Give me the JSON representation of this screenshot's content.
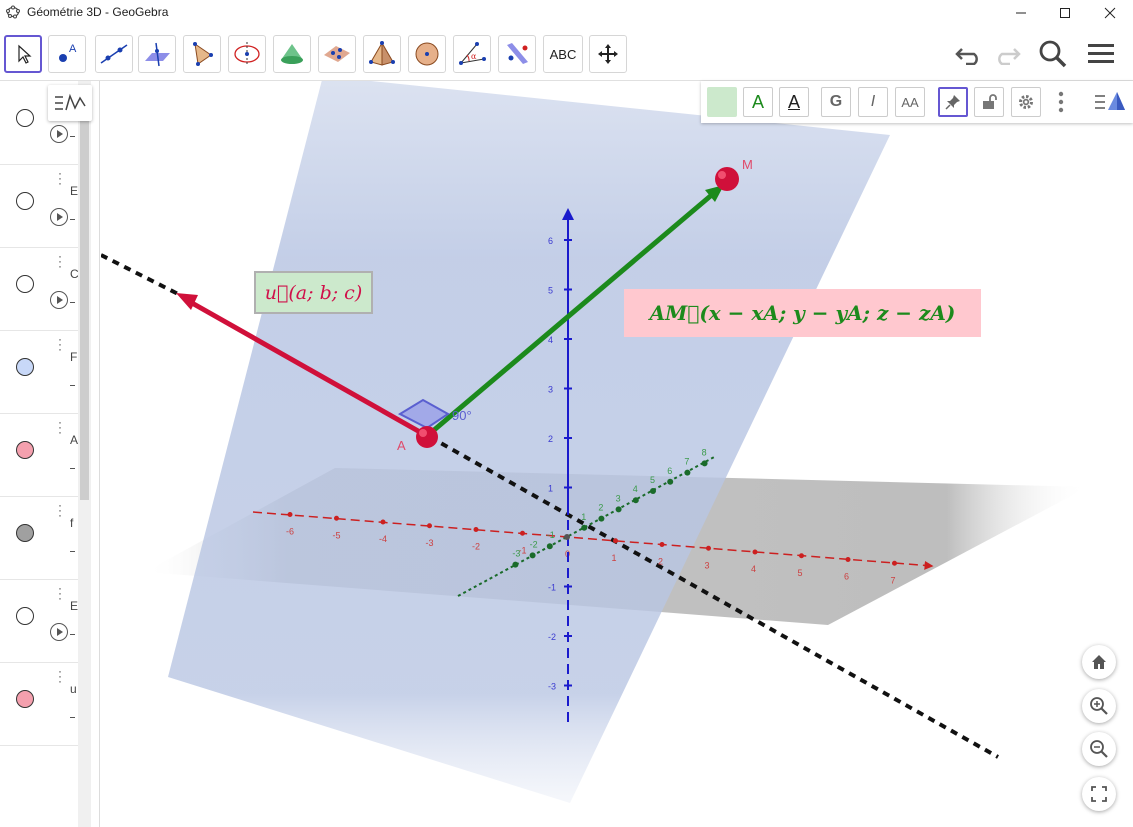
{
  "window": {
    "title": "Géométrie 3D - GeoGebra"
  },
  "toolbar": {
    "tools": [
      "move-tool",
      "point-tool",
      "line-tool",
      "perpendicular-line-tool",
      "polygon-tool",
      "circle-axis-tool",
      "cone-tool",
      "plane-tool",
      "pyramid-tool",
      "sphere-tool",
      "angle-tool",
      "reflect-tool",
      "text-tool",
      "move-view-tool"
    ],
    "text_tool_label": "ABC"
  },
  "algebra_view": {
    "rows": [
      {
        "color": "#ffffff",
        "letter": "",
        "play": true
      },
      {
        "color": "#ffffff",
        "letter": "E",
        "play": true
      },
      {
        "color": "#ffffff",
        "letter": "C",
        "play": true
      },
      {
        "color": "#c8d8f8",
        "letter": "F",
        "play": false
      },
      {
        "color": "#f4a0ae",
        "letter": "A",
        "play": false
      },
      {
        "color": "#a0a0a0",
        "letter": "f",
        "play": false
      },
      {
        "color": "#ffffff",
        "letter": "E",
        "play": true
      },
      {
        "color": "#f4a0ae",
        "letter": "u",
        "play": false
      }
    ]
  },
  "stylebar": {
    "buttons": [
      "G",
      "I",
      "AA"
    ],
    "text_color_label": "A",
    "bg_color_label": "A"
  },
  "scene": {
    "point_A": "A",
    "point_M": "M",
    "angle_label": "90°",
    "label_u": "u⃗(a; b; c)",
    "label_am": "AM⃗(x − xA; y − yA; z − zA)",
    "x_ticks": [
      "-6",
      "-5",
      "-4",
      "-3",
      "-2",
      "-1",
      "0",
      "1",
      "2",
      "3",
      "4",
      "5",
      "6",
      "7"
    ],
    "y_ticks": [
      "-3",
      "-2",
      "-1",
      "1",
      "2",
      "3",
      "4",
      "5",
      "6",
      "7",
      "8"
    ],
    "z_ticks": [
      "-3",
      "-2",
      "-1",
      "1",
      "2",
      "3",
      "4",
      "5",
      "6"
    ],
    "colors": {
      "x_axis": "#cc2020",
      "y_axis": "#1a6b2a",
      "z_axis": "#1a1acc",
      "vector_u": "#d0103a",
      "vector_am": "#1c8a1c",
      "plane": "#aab8dd",
      "floor": "#8a8a8a"
    }
  }
}
